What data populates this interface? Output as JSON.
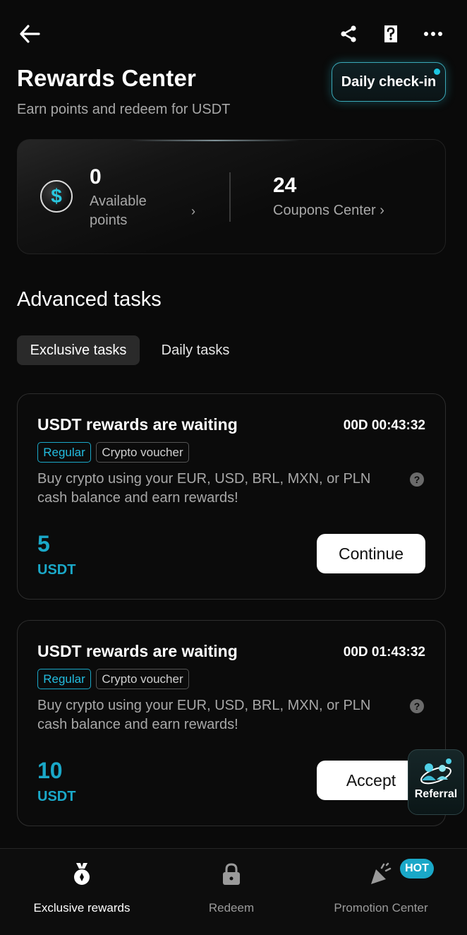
{
  "header": {
    "title": "Rewards Center",
    "subtitle": "Earn points and redeem for USDT",
    "daily_checkin_label": "Daily check-in",
    "icons": [
      "back-arrow-icon",
      "share-icon",
      "help-icon",
      "more-icon"
    ]
  },
  "points_card": {
    "points_value": "0",
    "points_label": "Available points",
    "coupons_value": "24",
    "coupons_label": "Coupons Center",
    "coin_symbol": "$"
  },
  "section": {
    "title": "Advanced tasks",
    "tabs": [
      {
        "label": "Exclusive tasks",
        "active": true
      },
      {
        "label": "Daily tasks",
        "active": false
      }
    ]
  },
  "tasks": [
    {
      "title": "USDT rewards are waiting",
      "timer": "00D 00:43:32",
      "tags": [
        "Regular",
        "Crypto voucher"
      ],
      "description": "Buy crypto using your EUR, USD, BRL, MXN, or PLN cash balance and earn rewards!",
      "amount": "5",
      "unit": "USDT",
      "button": "Continue"
    },
    {
      "title": "USDT rewards are waiting",
      "timer": "00D 01:43:32",
      "tags": [
        "Regular",
        "Crypto voucher"
      ],
      "description": "Buy crypto using your EUR, USD, BRL, MXN, or PLN cash balance and earn rewards!",
      "amount": "10",
      "unit": "USDT",
      "button": "Accept"
    }
  ],
  "referral": {
    "label": "Referral"
  },
  "bottom_nav": [
    {
      "label": "Exclusive rewards",
      "icon": "medal-icon",
      "active": true
    },
    {
      "label": "Redeem",
      "icon": "lock-icon",
      "active": false
    },
    {
      "label": "Promotion Center",
      "icon": "party-popper-icon",
      "active": false,
      "badge": "HOT"
    }
  ],
  "colors": {
    "accent": "#1aa8c8",
    "background": "#0a0a0a",
    "muted": "#a8a8a8"
  }
}
